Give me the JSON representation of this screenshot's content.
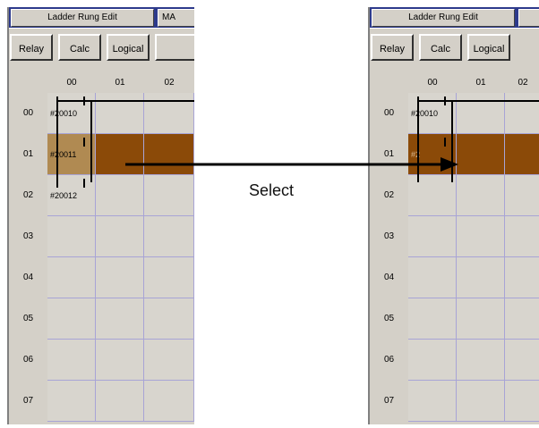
{
  "editor": {
    "tab_title": "Ladder Rung Edit",
    "tab_second": "MA",
    "buttons": [
      "Relay",
      "Calc",
      "Logical"
    ],
    "columns": [
      "00",
      "01",
      "02"
    ],
    "rows": [
      "00",
      "01",
      "02",
      "03",
      "04",
      "05",
      "06",
      "07"
    ],
    "contacts": [
      "#20010",
      "#20011",
      "#20012"
    ],
    "contacts_right": [
      "#20010",
      "#2"
    ]
  },
  "annotation": {
    "label": "Select"
  },
  "colors": {
    "selected_row": "#8b4a08",
    "title_bar": "#2d3a8c",
    "grid_line": "#a8a4d6"
  }
}
